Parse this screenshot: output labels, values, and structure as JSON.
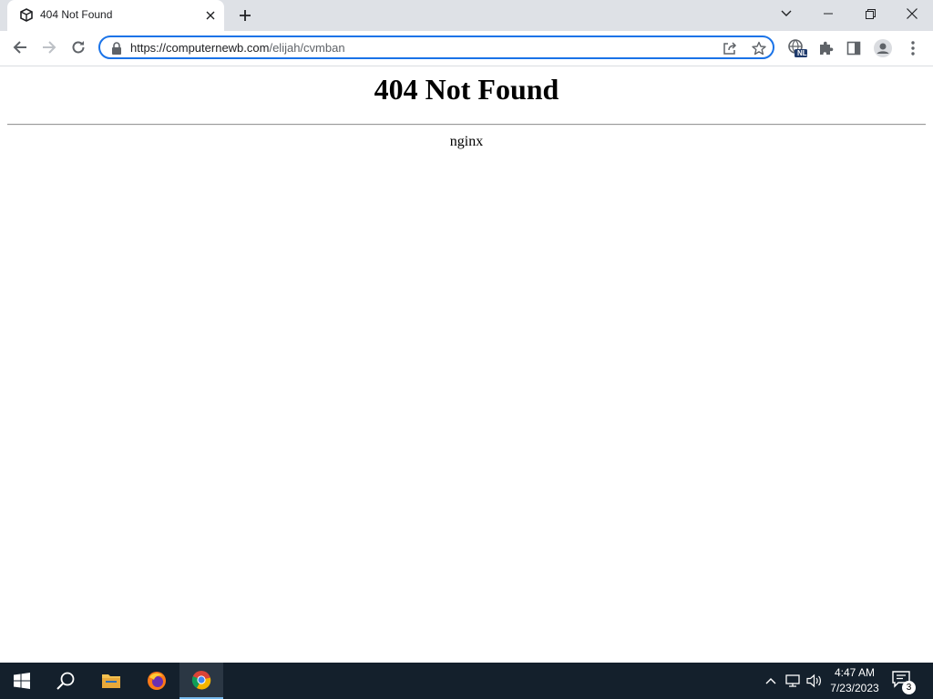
{
  "browser": {
    "tab": {
      "title": "404 Not Found"
    },
    "address_bar": {
      "url_host": "https://computernewb.com",
      "url_path": "/elijah/cvmban"
    },
    "icons": {
      "favicon": "cube-logo-icon",
      "tab_close": "close-icon",
      "new_tab": "plus-icon",
      "tab_search": "chevron-down-icon",
      "minimize": "minimize-icon",
      "restore": "restore-icon",
      "close_window": "close-icon",
      "back": "arrow-left-icon",
      "forward": "arrow-right-icon",
      "reload": "reload-icon",
      "lock": "lock-icon",
      "share": "share-icon",
      "bookmark": "star-icon",
      "translate_ext": "globe-icon",
      "extensions": "puzzle-icon",
      "side_panel": "side-panel-icon",
      "profile": "avatar-icon",
      "menu": "kebab-menu-icon"
    },
    "extension_badge": "NL"
  },
  "page": {
    "heading": "404 Not Found",
    "server": "nginx"
  },
  "taskbar": {
    "clock_time": "4:47 AM",
    "clock_date": "7/23/2023",
    "notification_count": "3",
    "apps": [
      "windows-start-icon",
      "search-icon",
      "file-explorer-icon",
      "firefox-icon",
      "chrome-icon"
    ],
    "tray": [
      "chevron-up-icon",
      "network-icon",
      "volume-icon",
      "notification-icon"
    ]
  },
  "colors": {
    "accent": "#1a73e8",
    "taskbar": "#14202c",
    "tabstrip": "#dee1e6"
  }
}
